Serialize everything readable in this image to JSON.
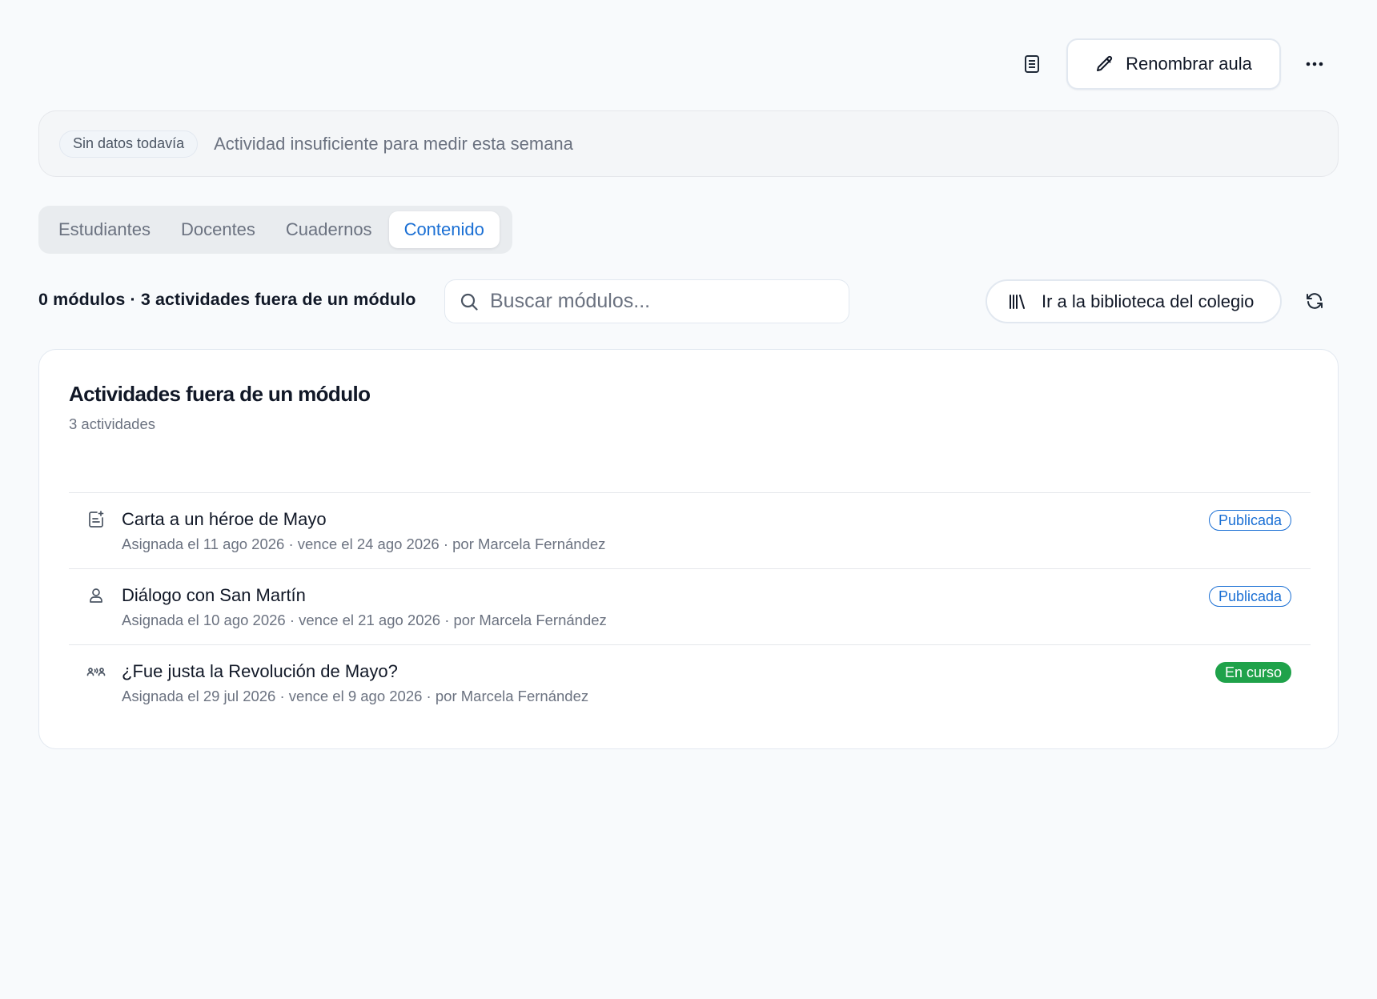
{
  "toolbar": {
    "doc_icon": "document-icon",
    "rename_label": "Renombrar aula",
    "rename_icon": "pencil-icon",
    "more_icon": "more-horizontal-icon"
  },
  "banner": {
    "badge": "Sin datos todavía",
    "message": "Actividad insuficiente para medir esta semana"
  },
  "tabs": [
    {
      "label": "Estudiantes",
      "active": false
    },
    {
      "label": "Docentes",
      "active": false
    },
    {
      "label": "Cuadernos",
      "active": false
    },
    {
      "label": "Contenido",
      "active": true
    }
  ],
  "content": {
    "summary": "0 módulos · 3 actividades fuera de un módulo",
    "search": {
      "placeholder": "Buscar módulos...",
      "value": ""
    },
    "library_button": "Ir a la biblioteca del colegio",
    "library_icon": "library-icon",
    "refresh_icon": "refresh-icon"
  },
  "card": {
    "title": "Actividades fuera de un módulo",
    "subtitle": "3 actividades",
    "activities": [
      {
        "icon": "assignment-icon",
        "title": "Carta a un héroe de Mayo",
        "meta": "Asignada el 11 ago 2026 · vence el 24 ago 2026 · por Marcela Fernández",
        "status": "Publicada"
      },
      {
        "icon": "person-icon",
        "title": "Diálogo con San Martín",
        "meta": "Asignada el 10 ago 2026 · vence el 21 ago 2026 · por Marcela Fernández",
        "status": "Publicada"
      },
      {
        "icon": "debate-group-icon",
        "title": "¿Fue justa la Revolución de Mayo?",
        "meta": "Asignada el 29 jul 2026 · vence el 9 ago 2026 · por Marcela Fernández",
        "status": "En curso"
      }
    ]
  },
  "colors": {
    "accent": "#1a6fd4",
    "published": "#1a6fd4",
    "ongoing": "#1fa24a",
    "background": "#f8fafc"
  }
}
